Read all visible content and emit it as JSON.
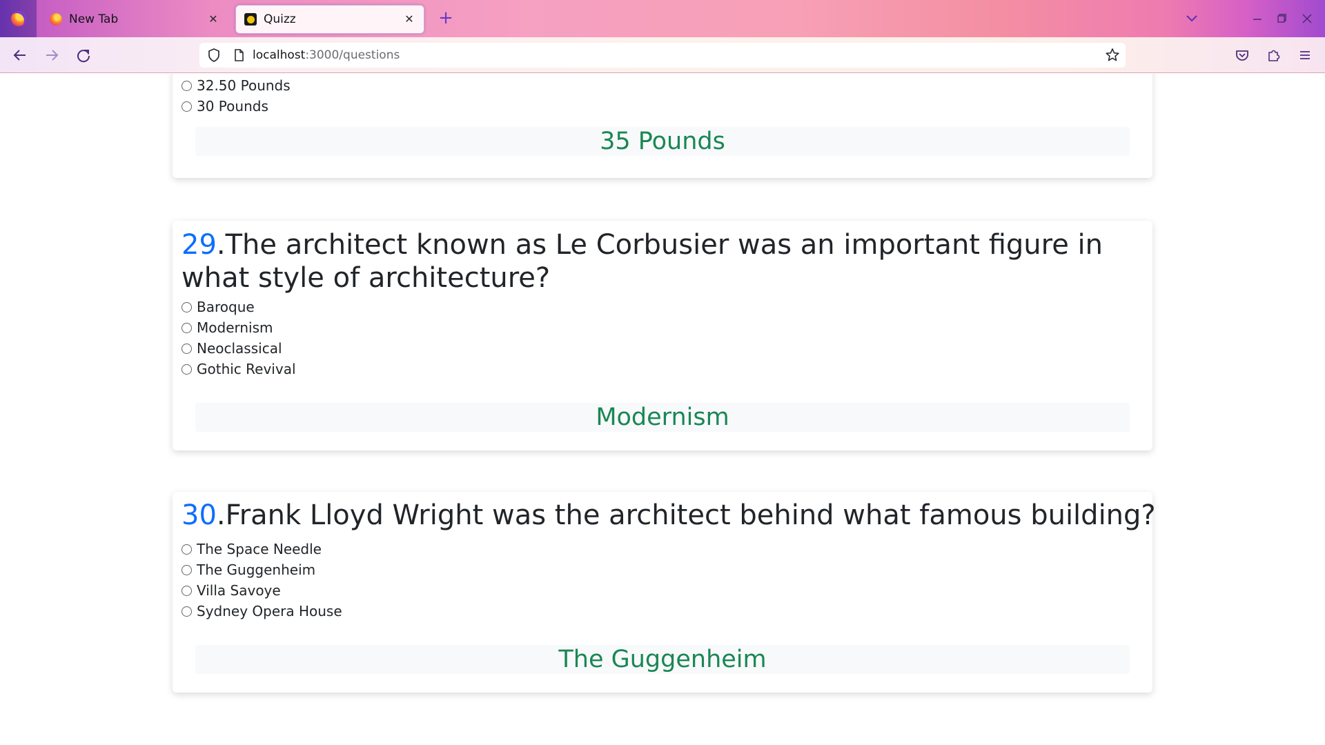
{
  "browser": {
    "tabs": [
      {
        "title": "New Tab",
        "active": false
      },
      {
        "title": "Quizz",
        "active": true
      }
    ],
    "url": {
      "host": "localhost",
      "path": ":3000/questions"
    }
  },
  "quiz": {
    "partial_question": {
      "options": [
        "32.50 Pounds",
        "30 Pounds"
      ],
      "answer": "35 Pounds"
    },
    "questions": [
      {
        "number": "29",
        "text": ".The architect known as Le Corbusier was an important figure in what style of architecture?",
        "options": [
          "Baroque",
          "Modernism",
          "Neoclassical",
          "Gothic Revival"
        ],
        "answer": "Modernism"
      },
      {
        "number": "30",
        "text": ".Frank Lloyd Wright was the architect behind what famous building?",
        "options": [
          "The Space Needle",
          "The Guggenheim",
          "Villa Savoye",
          "Sydney Opera House"
        ],
        "answer": "The Guggenheim"
      }
    ]
  },
  "colors": {
    "question_number": "#0d6efd",
    "answer_text": "#198754",
    "answer_bg": "#f8f9fa"
  }
}
